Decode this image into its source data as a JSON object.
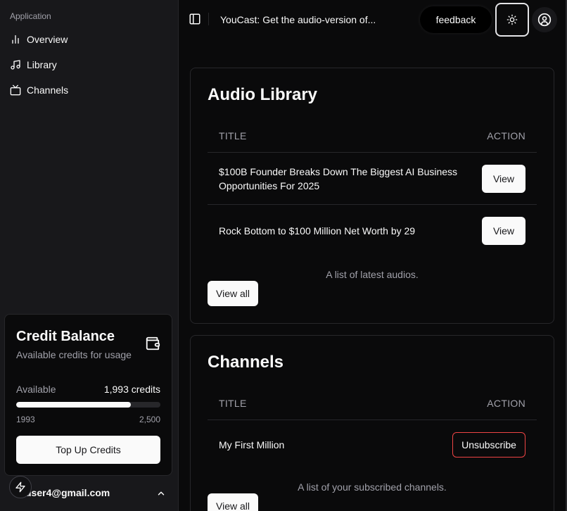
{
  "sidebar": {
    "group_label": "Application",
    "items": [
      {
        "label": "Overview",
        "icon": "bar-chart-icon"
      },
      {
        "label": "Library",
        "icon": "music-note-icon"
      },
      {
        "label": "Channels",
        "icon": "tv-icon"
      }
    ],
    "credit": {
      "title": "Credit Balance",
      "subtitle": "Available credits for usage",
      "available_label": "Available",
      "available_value": "1,993 credits",
      "current": "1993",
      "max": "2,500",
      "progress_fraction": 0.797,
      "topup_label": "Top Up Credits"
    },
    "user": {
      "email": "user4@gmail.com"
    }
  },
  "header": {
    "title": "YouCast: Get the audio-version of...",
    "feedback_label": "feedback"
  },
  "library": {
    "title": "Audio Library",
    "col_title": "TITLE",
    "col_action": "ACTION",
    "rows": [
      {
        "title": "$100B Founder Breaks Down The Biggest AI Business Opportunities For 2025",
        "action": "View"
      },
      {
        "title": "Rock Bottom to $100 Million Net Worth by 29",
        "action": "View"
      }
    ],
    "caption": "A list of latest audios.",
    "view_all": "View all"
  },
  "channels": {
    "title": "Channels",
    "col_title": "TITLE",
    "col_action": "ACTION",
    "rows": [
      {
        "title": "My First Million",
        "action": "Unsubscribe"
      }
    ],
    "caption": "A list of your subscribed channels.",
    "view_all": "View all"
  },
  "colors": {
    "background": "#0a0a0b",
    "sidebar": "#18181b",
    "border": "#27272a",
    "destructive": "#ef4444"
  }
}
